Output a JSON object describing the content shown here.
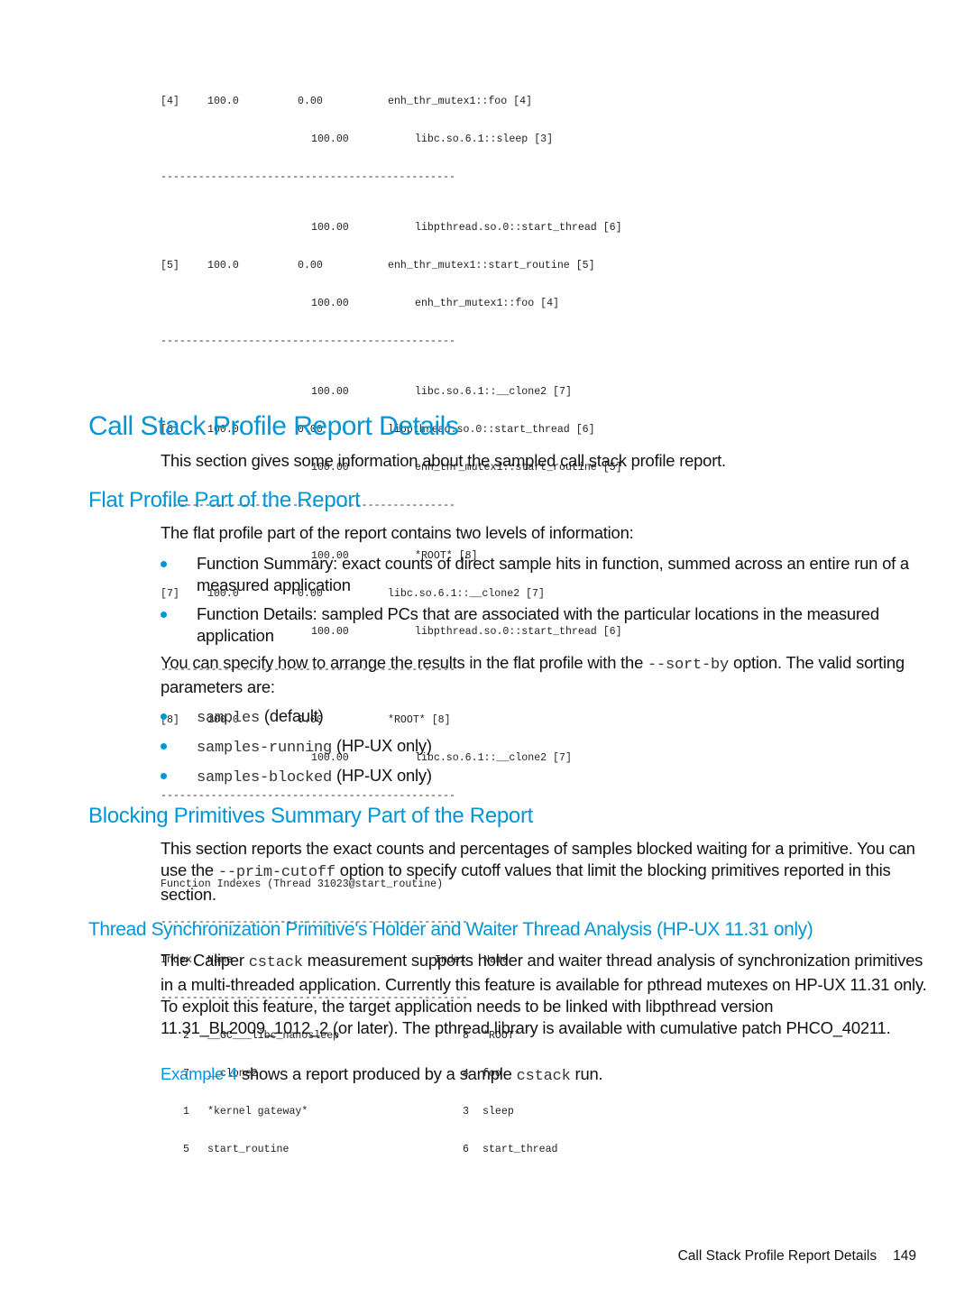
{
  "call_graph": {
    "entries": [
      {
        "parents": [],
        "index": "[4]",
        "pct": "100.0",
        "self": "0.00",
        "name": "enh_thr_mutex1::foo [4]",
        "children": [
          {
            "pct": "100.00",
            "name": "libc.so.6.1::sleep [3]"
          }
        ]
      },
      {
        "parents": [
          {
            "pct": "100.00",
            "name": "libpthread.so.0::start_thread [6]"
          }
        ],
        "index": "[5]",
        "pct": "100.0",
        "self": "0.00",
        "name": "enh_thr_mutex1::start_routine [5]",
        "children": [
          {
            "pct": "100.00",
            "name": "enh_thr_mutex1::foo [4]"
          }
        ]
      },
      {
        "parents": [
          {
            "pct": "100.00",
            "name": "libc.so.6.1::__clone2 [7]"
          }
        ],
        "index": "[6]",
        "pct": "100.0",
        "self": "0.00",
        "name": "libpthread.so.0::start_thread [6]",
        "children": [
          {
            "pct": "100.00",
            "name": "enh_thr_mutex1::start_routine [5]"
          }
        ]
      },
      {
        "parents": [
          {
            "pct": "100.00",
            "name": "*ROOT* [8]"
          }
        ],
        "index": "[7]",
        "pct": "100.0",
        "self": "0.00",
        "name": "libc.so.6.1::__clone2 [7]",
        "children": [
          {
            "pct": "100.00",
            "name": "libpthread.so.0::start_thread [6]"
          }
        ]
      },
      {
        "parents": [],
        "index": "[8]",
        "pct": "100.0",
        "self": "0.00",
        "name": "*ROOT* [8]",
        "children": [
          {
            "pct": "100.00",
            "name": "libc.so.6.1::__clone2 [7]"
          }
        ]
      }
    ],
    "separator": "-----------------------------------------------"
  },
  "function_indexes": {
    "title": "Function Indexes (Thread 31023@start_routine)",
    "separator": "-------------------------------------------------",
    "headers": [
      "Index",
      "Name",
      "Index",
      "Name"
    ],
    "rows": [
      {
        "i1": "2",
        "n1": "__GC___libc_nanosleep",
        "i2": "8",
        "n2": "*ROOT*"
      },
      {
        "i1": "7",
        "n1": "__clone2",
        "i2": "4",
        "n2": "foo"
      },
      {
        "i1": "1",
        "n1": "*kernel gateway*",
        "i2": "3",
        "n2": "sleep"
      },
      {
        "i1": "5",
        "n1": "start_routine",
        "i2": "6",
        "n2": "start_thread"
      }
    ]
  },
  "section_main": {
    "title": "Call Stack Profile Report Details",
    "intro": "This section gives some information about the sampled call stack profile report."
  },
  "section_flat": {
    "title": "Flat Profile Part of the Report",
    "intro": "The flat profile part of the report contains two levels of information:",
    "bullets": [
      "Function Summary: exact counts of direct sample hits in function, summed across an entire run of a measured application",
      "Function Details: sampled PCs that are associated with the particular locations in the measured application"
    ],
    "sort_text_before": "You can specify how to arrange the results in the flat profile with the ",
    "sort_option": "--sort-by",
    "sort_text_after": " option. The valid sorting parameters are:",
    "sort_params": [
      {
        "code": "samples",
        "note": " (default)"
      },
      {
        "code": "samples-running",
        "note": " (HP-UX only)"
      },
      {
        "code": "samples-blocked",
        "note": " (HP-UX only)"
      }
    ]
  },
  "section_blocking": {
    "title": "Blocking Primitives Summary Part of the Report",
    "text_before": "This section reports the exact counts and percentages of samples blocked waiting for a primitive. You can use the ",
    "option": "--prim-cutoff",
    "text_after": " option to specify cutoff values that limit the blocking primitives reported in this section."
  },
  "section_thread": {
    "title": "Thread Synchronization Primitive's Holder and Waiter Thread Analysis (HP-UX 11.31 only)",
    "p1_before": "The Caliper ",
    "p1_code": "cstack",
    "p1_after": " measurement supports holder and waiter thread analysis of synchronization primitives in a multi-threaded application. Currently this feature is available for pthread mutexes on HP-UX 11.31 only. To exploit this feature, the target application needs to be linked with libpthread version 11.31_BL2009_1012_2 (or later). The pthread library is available with cumulative patch PHCO_40211.",
    "p2_link": "Example 4",
    "p2_before": " shows a report produced by a sample ",
    "p2_code": "cstack",
    "p2_after": " run."
  },
  "footer": {
    "section": "Call Stack Profile Report Details",
    "page": "149"
  },
  "colors": {
    "accent": "#0096d6"
  }
}
